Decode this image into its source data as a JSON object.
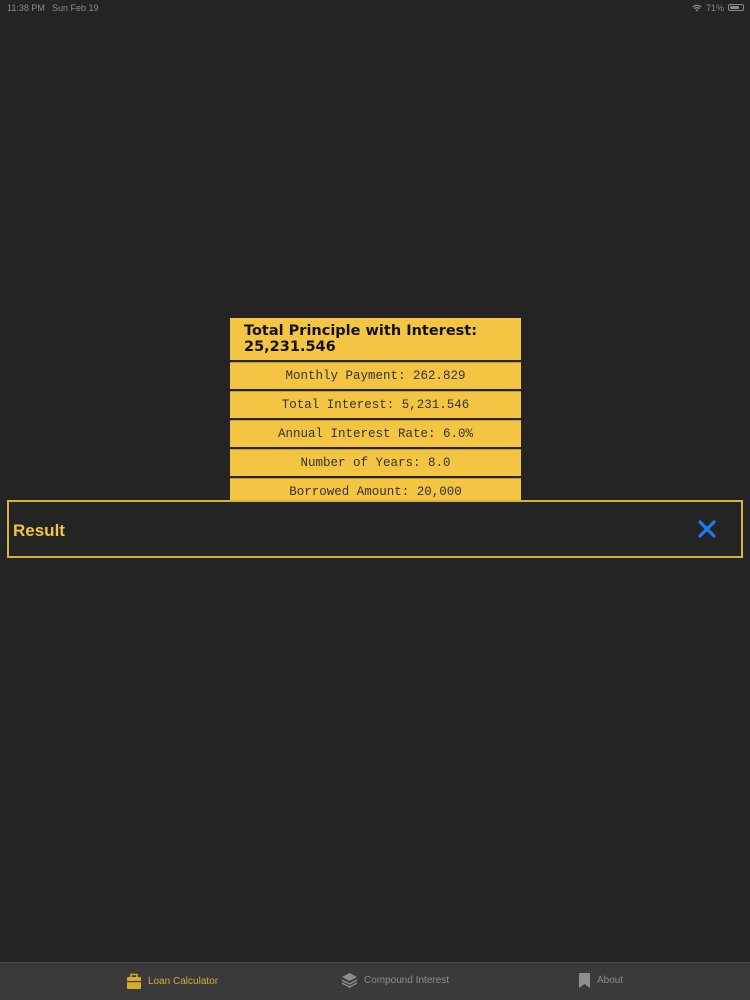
{
  "status_bar": {
    "time": "11:38 PM",
    "date": "Sun Feb 19",
    "battery": "71%",
    "battery_level": 0.71
  },
  "result_card": {
    "total_label": "Total Principle with Interest: 25,231.546",
    "rows": [
      "Monthly Payment: 262.829",
      "Total Interest: 5,231.546",
      "Annual Interest Rate: 6.0%",
      "Number of Years:  8.0",
      "Borrowed Amount: 20,000"
    ]
  },
  "result_bar": {
    "title": "Result",
    "close_icon": "close-icon"
  },
  "tab_bar": {
    "tabs": [
      {
        "label": "Loan Calculator",
        "icon": "briefcase-icon",
        "active": true
      },
      {
        "label": "Compound Interest",
        "icon": "layers-icon",
        "active": false
      },
      {
        "label": "About",
        "icon": "bookmark-icon",
        "active": false
      }
    ]
  },
  "colors": {
    "background": "#242424",
    "accent": "#f3c542",
    "close_icon": "#1e7cf0",
    "tab_active": "#d4ac30",
    "tab_inactive": "#8d8d8d"
  }
}
